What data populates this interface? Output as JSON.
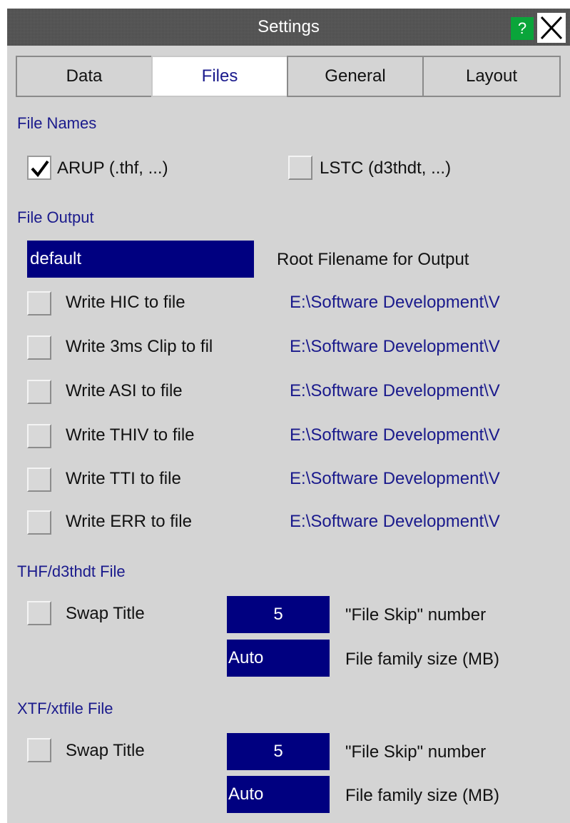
{
  "window": {
    "title": "Settings",
    "help_label": "?"
  },
  "tabs": [
    {
      "label": "Data",
      "active": false
    },
    {
      "label": "Files",
      "active": true
    },
    {
      "label": "General",
      "active": false
    },
    {
      "label": "Layout",
      "active": false
    }
  ],
  "file_names": {
    "heading": "File Names",
    "arup": {
      "label": "ARUP (.thf, ...)",
      "checked": true
    },
    "lstc": {
      "label": "LSTC (d3thdt, ...)",
      "checked": false
    }
  },
  "file_output": {
    "heading": "File Output",
    "root_filename_value": "default",
    "root_filename_label": "Root Filename for Output",
    "rows": [
      {
        "label": "Write HIC to file",
        "path": "E:\\Software Development\\V",
        "checked": false
      },
      {
        "label": "Write 3ms Clip to fil",
        "path": "E:\\Software Development\\V",
        "checked": false
      },
      {
        "label": "Write ASI to file",
        "path": "E:\\Software Development\\V",
        "checked": false
      },
      {
        "label": "Write THIV to file",
        "path": "E:\\Software Development\\V",
        "checked": false
      },
      {
        "label": "Write TTI to file",
        "path": "E:\\Software Development\\V",
        "checked": false
      },
      {
        "label": "Write ERR to file",
        "path": "E:\\Software Development\\V",
        "checked": false
      }
    ]
  },
  "thf_file": {
    "heading": "THF/d3thdt File",
    "swap_title_label": "Swap Title",
    "swap_title_checked": false,
    "file_skip_value": "5",
    "file_skip_label": "\"File Skip\" number",
    "family_size_value": "Auto",
    "family_size_label": "File family size (MB)"
  },
  "xtf_file": {
    "heading": "XTF/xtfile File",
    "swap_title_label": "Swap Title",
    "swap_title_checked": false,
    "file_skip_value": "5",
    "file_skip_label": "\"File Skip\" number",
    "family_size_value": "Auto",
    "family_size_label": "File family size (MB)"
  },
  "colors": {
    "accent_text": "#1a1a8c",
    "field_bg": "#000080",
    "help_bg": "#0aa53a",
    "panel_bg": "#d4d4d4",
    "titlebar_bg": "#4a4a4a"
  }
}
